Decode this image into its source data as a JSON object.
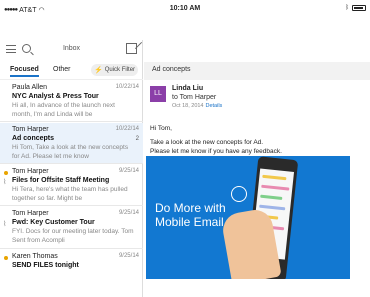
{
  "status_bar": {
    "carrier": "AT&T",
    "time": "10:10 AM"
  },
  "inbox": {
    "title": "Inbox",
    "tabs": [
      {
        "label": "Focused"
      },
      {
        "label": "Other"
      }
    ],
    "quick_filter_label": "Quick Filter",
    "messages": [
      {
        "sender": "Paula Allen",
        "date": "10/22/14",
        "subject": "NYC Analyst & Press Tour",
        "preview": "Hi all, In advance of the launch next month, I'm and Linda will be"
      },
      {
        "sender": "Tom Harper",
        "date": "10/22/14",
        "subject": "Ad concepts",
        "count": "2",
        "preview": "Hi Tom, Take a look at the new concepts for Ad. Please let me know"
      },
      {
        "sender": "Tom Harper",
        "date": "9/25/14",
        "subject": "Files for Offsite Staff Meeting",
        "preview": "Hi Tera, here's what the team has pulled together so far. Might be"
      },
      {
        "sender": "Tom Harper",
        "date": "9/25/14",
        "subject": "Fwd: Key Customer Tour",
        "preview": "FYI. Docs for our meeting later today. Tom Sent from Acompli"
      },
      {
        "sender": "Karen Thomas",
        "date": "9/25/14",
        "subject": "SEND FILES tonight",
        "preview": ""
      }
    ]
  },
  "conversation": {
    "title": "Ad concepts",
    "avatar_initials": "LL",
    "from": "Linda Liu",
    "to": "to Tom Harper",
    "date": "Oct 18, 2014",
    "details_label": "Details",
    "body_line1": "Hi Tom,",
    "body_line2": "Take a look at the new concepts for Ad.",
    "body_line3": "Please let me know if you have any feedback.",
    "banner_text_line1": "Do More with",
    "banner_text_line2": "Mobile Email"
  },
  "colors": {
    "accent": "#1a73c8",
    "banner": "#1278d1",
    "avatar": "#8b3fa8",
    "flag_dot": "#e8a400"
  }
}
